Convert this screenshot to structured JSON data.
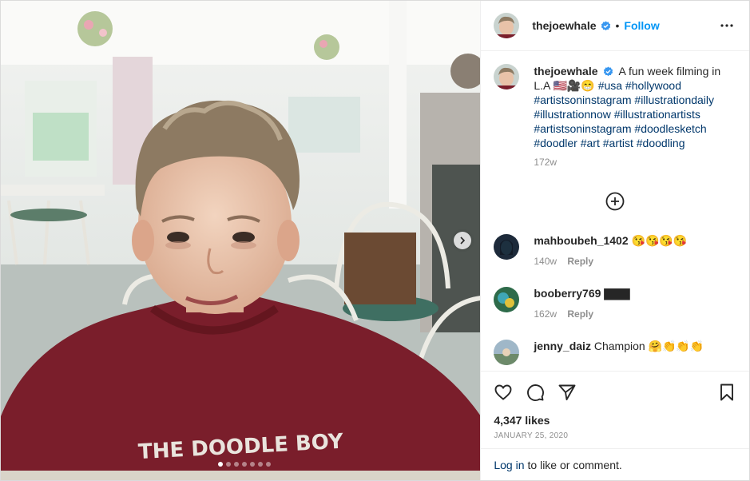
{
  "post": {
    "username": "thejoewhale",
    "follow_label": "Follow",
    "dot_separator": "•",
    "caption_text": "A fun week filming in L.A 🇺🇸🎥😁",
    "caption_hashtags": "#usa #hollywood #artistsoninstagram #illustrationdaily #illustrationnow #illustrationartists #artistsoninstagram #doodlesketch #doodler #art #artist #doodling",
    "caption_time": "172w",
    "photo_shirt_text": "THE DOODLE BOY",
    "carousel_count": 7,
    "carousel_active": 0
  },
  "comments": [
    {
      "user": "mahboubeh_1402",
      "text": "😘😘😘😘",
      "time": "140w",
      "reply": "Reply",
      "avatar_color": "#1d2a3a"
    },
    {
      "user": "booberry769",
      "text": "▇▇▇",
      "time": "162w",
      "reply": "Reply",
      "avatar_color": "#2e6b4a"
    },
    {
      "user": "jenny_daiz",
      "text": "Champion 🤗👏👏👏",
      "time": "",
      "reply": "",
      "avatar_color": "#9fb7c8"
    }
  ],
  "stats": {
    "likes": "4,347 likes",
    "date": "JANUARY 25, 2020"
  },
  "footer": {
    "login_link": "Log in",
    "login_text": "to like or comment."
  },
  "colors": {
    "link_blue": "#0095f6",
    "hashtag_blue": "#00376b",
    "muted_gray": "#8e8e8e",
    "sweater_maroon": "#7a1e2b"
  }
}
